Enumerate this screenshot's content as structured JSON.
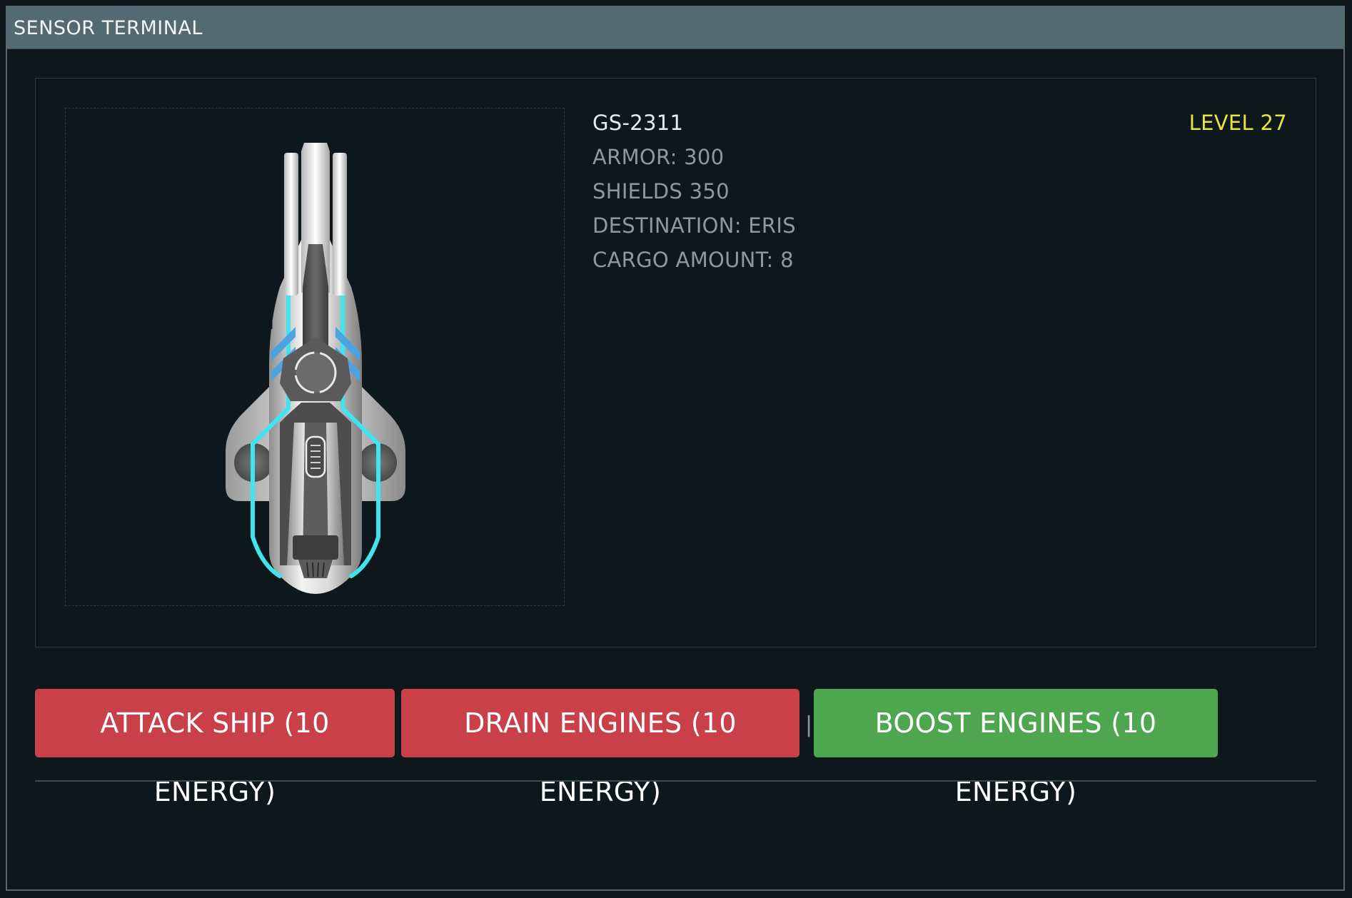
{
  "window": {
    "title": "SENSOR TERMINAL"
  },
  "ship": {
    "name": "GS-2311",
    "level": "LEVEL 27",
    "image_icon": "spaceship-icon",
    "stats": {
      "armor": "ARMOR: 300",
      "shields": "SHIELDS 350",
      "destination": "DESTINATION: ERIS",
      "cargo": "CARGO AMOUNT: 8"
    }
  },
  "actions": {
    "attack_label": "ATTACK SHIP (10 ENERGY)",
    "drain_label": "DRAIN ENGINES (10 ENERGY)",
    "separator": "|",
    "boost_label": "BOOST ENGINES (10 ENERGY)"
  },
  "colors": {
    "title_bar": "#546a73",
    "background": "#0e171c",
    "level_text": "#e4e63a",
    "attack_button": "#c94049",
    "boost_button": "#4ea64e",
    "ship_glow": "#3fe4ef"
  }
}
